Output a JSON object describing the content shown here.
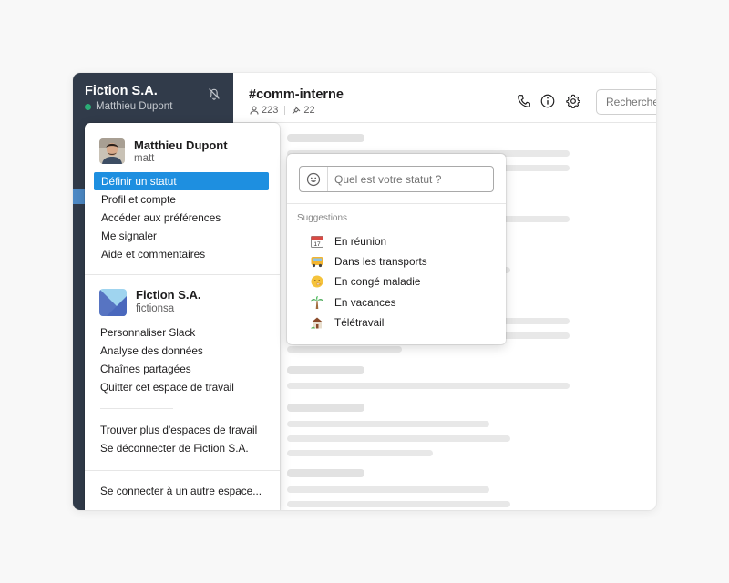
{
  "workspace": {
    "name": "Fiction S.A.",
    "current_user": "Matthieu Dupont"
  },
  "channel": {
    "name": "#comm-interne",
    "members": "223",
    "pinned": "22"
  },
  "search": {
    "placeholder": "Rechercher"
  },
  "user_menu": {
    "user_name": "Matthieu Dupont",
    "user_handle": "matt",
    "items": [
      {
        "label": "Définir un statut",
        "active": true
      },
      {
        "label": "Profil et compte"
      },
      {
        "label": "Accéder aux préférences"
      },
      {
        "label": "Me signaler"
      },
      {
        "label": "Aide et commentaires"
      }
    ],
    "workspace_name": "Fiction S.A.",
    "workspace_handle": "fictionsa",
    "workspace_items": [
      {
        "label": "Personnaliser Slack"
      },
      {
        "label": "Analyse des données"
      },
      {
        "label": "Chaînes partagées"
      },
      {
        "label": "Quitter cet espace de travail"
      }
    ],
    "other_items": [
      {
        "label": "Trouver plus d'espaces de travail"
      },
      {
        "label": "Se déconnecter de Fiction S.A."
      }
    ],
    "footer_item": "Se connecter à un autre espace..."
  },
  "status_popup": {
    "placeholder": "Quel est votre statut ?",
    "suggestions_title": "Suggestions",
    "suggestions": [
      {
        "label": "En réunion",
        "icon": "calendar-icon"
      },
      {
        "label": "Dans les transports",
        "icon": "bus-icon"
      },
      {
        "label": "En congé maladie",
        "icon": "sick-face-icon"
      },
      {
        "label": "En vacances",
        "icon": "palm-tree-icon"
      },
      {
        "label": "Télétravail",
        "icon": "house-icon"
      }
    ]
  },
  "colors": {
    "sidebar": "#313b4a",
    "active_item": "#1e8fe0",
    "presence": "#2bac76"
  }
}
